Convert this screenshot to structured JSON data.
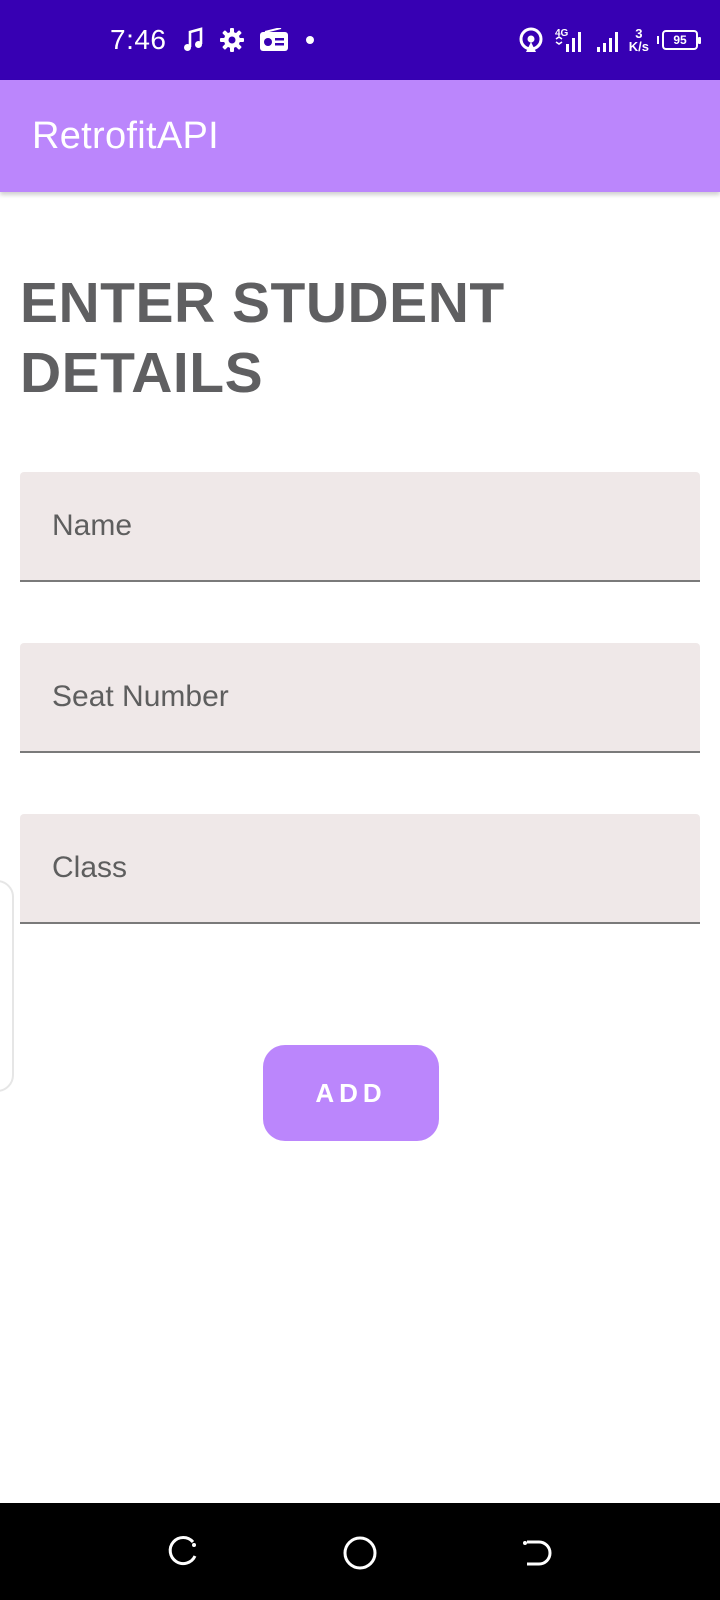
{
  "status_bar": {
    "time": "7:46",
    "network_type": "4G",
    "net_speed_value": "3",
    "net_speed_unit": "K/s",
    "battery": "95",
    "icons": [
      "music-note-icon",
      "gear-icon",
      "radio-icon",
      "dot-icon",
      "hotspot-icon",
      "signal-icon",
      "signal-icon",
      "battery-icon"
    ]
  },
  "app_bar": {
    "title": "RetrofitAPI"
  },
  "form": {
    "heading": "ENTER STUDENT DETAILS",
    "name_placeholder": "Name",
    "seat_placeholder": "Seat Number",
    "class_placeholder": "Class",
    "name_value": "",
    "seat_value": "",
    "class_value": "",
    "add_label": "ADD"
  },
  "nav_bar": {
    "icons": [
      "recent-apps-icon",
      "home-icon",
      "back-icon"
    ]
  },
  "colors": {
    "status_bar": "#3700b3",
    "primary": "#bb86fc",
    "field_bg": "#efe8e8",
    "heading_text": "#5f5f61",
    "nav_bar": "#000000"
  }
}
